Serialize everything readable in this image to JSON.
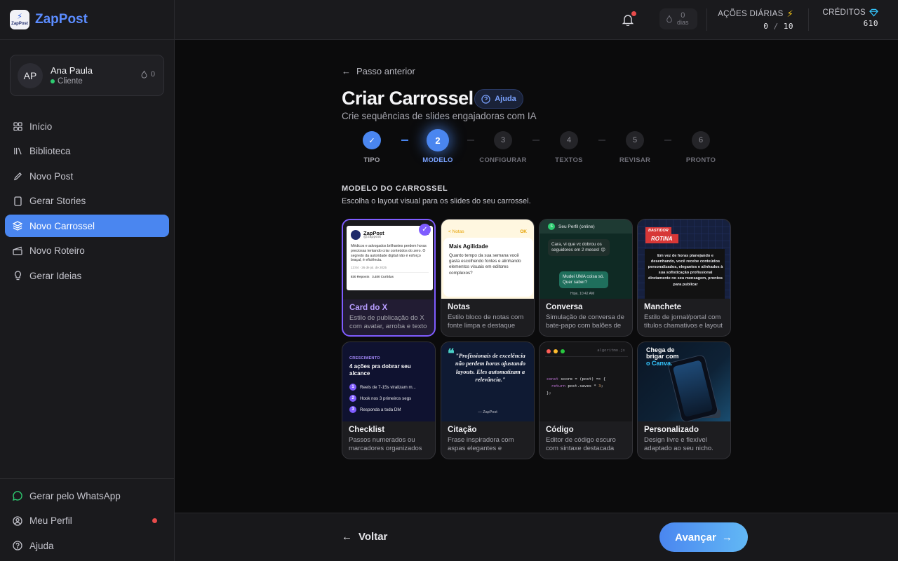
{
  "brand": {
    "name": "ZapPost",
    "logo_text": "ZapPost"
  },
  "user": {
    "initials": "AP",
    "name": "Ana Paula",
    "role": "Cliente",
    "streak": "0"
  },
  "nav": [
    {
      "label": "Início",
      "icon": "grid-icon"
    },
    {
      "label": "Biblioteca",
      "icon": "library-icon"
    },
    {
      "label": "Novo Post",
      "icon": "pencil-icon"
    },
    {
      "label": "Gerar Stories",
      "icon": "phone-icon"
    },
    {
      "label": "Novo Carrossel",
      "icon": "layers-icon"
    },
    {
      "label": "Novo Roteiro",
      "icon": "clapper-icon"
    },
    {
      "label": "Gerar Ideias",
      "icon": "lightbulb-icon"
    }
  ],
  "nav_active_index": 4,
  "bottom_nav": [
    {
      "label": "Gerar pelo WhatsApp",
      "icon": "whatsapp-icon"
    },
    {
      "label": "Meu Perfil",
      "icon": "user-circle-icon"
    },
    {
      "label": "Ajuda",
      "icon": "help-circle-icon"
    }
  ],
  "topbar": {
    "streak_value": "0",
    "streak_unit": "dias",
    "daily_label": "AÇÕES DIÁRIAS",
    "daily_used": "0",
    "daily_sep": "/",
    "daily_total": "10",
    "credits_label": "CRÉDITOS",
    "credits_value": "610"
  },
  "page": {
    "back_label": "Passo anterior",
    "title": "Criar Carrossel",
    "help_label": "Ajuda",
    "subtitle": "Crie sequências de slides engajadoras com IA"
  },
  "steps": [
    {
      "num": "✓",
      "label": "TIPO",
      "state": "done"
    },
    {
      "num": "2",
      "label": "MODELO",
      "state": "current"
    },
    {
      "num": "3",
      "label": "CONFIGURAR",
      "state": "todo"
    },
    {
      "num": "4",
      "label": "TEXTOS",
      "state": "todo"
    },
    {
      "num": "5",
      "label": "REVISAR",
      "state": "todo"
    },
    {
      "num": "6",
      "label": "PRONTO",
      "state": "todo"
    }
  ],
  "section": {
    "title": "MODELO DO CARROSSEL",
    "subtitle": "Escolha o layout visual para os slides do seu carrossel."
  },
  "cards": [
    {
      "title": "Card do X",
      "desc": "Estilo de publicação do X com avatar, arroba e texto"
    },
    {
      "title": "Notas",
      "desc": "Estilo bloco de notas com fonte limpa e destaque"
    },
    {
      "title": "Conversa",
      "desc": "Simulação de conversa de bate-papo com balões de"
    },
    {
      "title": "Manchete",
      "desc": "Estilo de jornal/portal com títulos chamativos e layout"
    },
    {
      "title": "Checklist",
      "desc": "Passos numerados ou marcadores organizados"
    },
    {
      "title": "Citação",
      "desc": "Frase inspiradora com aspas elegantes e"
    },
    {
      "title": "Código",
      "desc": "Editor de código escuro com sintaxe destacada"
    },
    {
      "title": "Personalizado",
      "desc": "Design livre e flexível adaptado ao seu nicho."
    }
  ],
  "selected_card_index": 0,
  "thumbs": {
    "x": {
      "name": "ZapPost",
      "handle": "@zappost",
      "mark": "X",
      "text": "Médicos e advogados brilhantes perdem horas preciosas tentando criar conteúdos do zero. O segredo da autoridade digital não é esforço braçal, é eficiência.",
      "date": "13:04 · 26 de jul. de 2025",
      "reposts": "830 Reposts",
      "likes": "3.400 Curtidas"
    },
    "notas": {
      "back": "< Notas",
      "ok": "OK",
      "title": "Mais Agilidade",
      "body": "Quanto tempo da sua semana você gasta escolhendo fontes e alinhando elementos visuais em editores complexos?"
    },
    "conversa": {
      "avatar": "S",
      "header": "Seu Perfil (online)",
      "msg1": "Cara, vi que vc dobrou os seguidores em 2 meses! 😮",
      "msg2": "Mudei UMA coisa só. Quer saber?",
      "time": "Hoje, 10:42 AM"
    },
    "manchete": {
      "tag1": "BASTIDOR",
      "tag2": "ROTINA",
      "text": "Em vez de horas planejando e desenhando, você recebe conteúdos personalizados, elegantes e alinhados à sua sofisticação profissional diretamente no seu mensagem, prontos para publicar"
    },
    "checklist": {
      "kicker": "CRESCIMENTO",
      "title": "4 ações pra dobrar seu alcance",
      "items": [
        "Reels de 7-15s viralizam m...",
        "Hook nos 3 primeiros segs",
        "Responda a toda DM"
      ]
    },
    "citacao": {
      "quote_mark": "❝",
      "text": "\"Profissionais de excelência não perdem horas ajustando layouts. Eles automatizam a relevância.\"",
      "author": "— ZapPost"
    },
    "codigo": {
      "filename": "algoritmo.js",
      "line1_kw": "const",
      "line1_var": " score = (post) => {",
      "line2_kw": "  return",
      "line2_rest": " post.saves * ",
      "line2_num": "3",
      "line2_end": ";",
      "line3": "};"
    },
    "personalizado": {
      "line1": "Chega de",
      "line2": "brigar com",
      "line3": "o Canva."
    }
  },
  "footer": {
    "back_label": "Voltar",
    "next_label": "Avançar"
  },
  "colors": {
    "accent": "#4a86f0",
    "selected": "#7f5cff",
    "notify": "#e84b4b",
    "online": "#2ecc71"
  }
}
